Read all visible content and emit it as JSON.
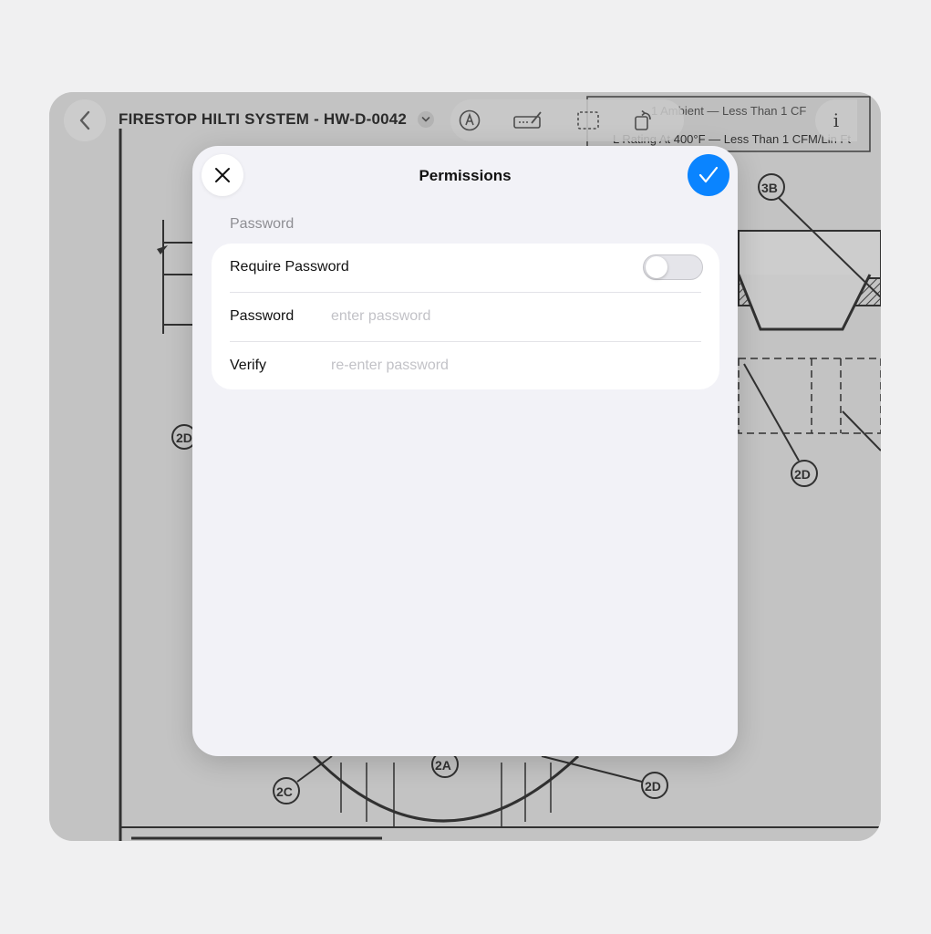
{
  "toolbar": {
    "document_title": "FIRESTOP HILTI SYSTEM - HW-D-0042",
    "info_label": "i",
    "icons": [
      "chevron-left-icon",
      "chevron-down-icon",
      "pen-tip-icon",
      "signature-icon",
      "selection-icon",
      "rotate-icon",
      "info-icon"
    ]
  },
  "drawing": {
    "callouts": [
      "3B",
      "2D",
      "2D",
      "2D",
      "2A",
      "2C",
      "2D"
    ],
    "note_line_1": "1 Ambient — Less Than 1 CF",
    "note_line_2": "L Rating At 400°F — Less Than 1 CFM/Lin Ft"
  },
  "modal": {
    "title": "Permissions",
    "section_header": "Password",
    "rows": {
      "require_password": {
        "label": "Require Password",
        "enabled": false
      },
      "password": {
        "label": "Password",
        "placeholder": "enter password",
        "value": ""
      },
      "verify": {
        "label": "Verify",
        "placeholder": "re-enter password",
        "value": ""
      }
    }
  },
  "colors": {
    "accent": "#0a84ff",
    "modal_background": "#f2f2f7",
    "card_background": "#ffffff",
    "secondary_text": "#8e8e93",
    "placeholder_text": "#c2c2c7"
  }
}
